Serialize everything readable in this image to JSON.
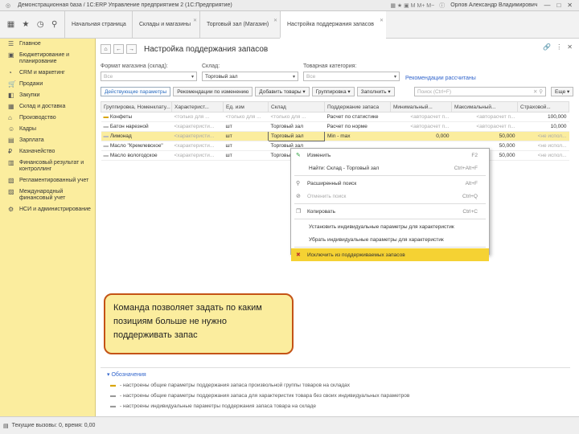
{
  "window": {
    "title": "Демонстрационная база / 1С:ERP Управление предприятием 2  (1С:Предприятие)",
    "user": "Орлов Александр Владимирович"
  },
  "tabs": [
    {
      "label": "Начальная страница"
    },
    {
      "label": "Склады и магазины"
    },
    {
      "label": "Торговый зал (Магазин)"
    },
    {
      "label": "Настройка поддержания запасов"
    }
  ],
  "sidebar": {
    "items": [
      {
        "label": "Главное",
        "icon": "list-icon"
      },
      {
        "label": "Бюджетирование и планирование",
        "icon": "budget-icon"
      },
      {
        "label": "CRM и маркетинг",
        "icon": "pie-icon"
      },
      {
        "label": "Продажи",
        "icon": "cart-icon"
      },
      {
        "label": "Закупки",
        "icon": "purchase-icon"
      },
      {
        "label": "Склад и доставка",
        "icon": "warehouse-icon"
      },
      {
        "label": "Производство",
        "icon": "factory-icon"
      },
      {
        "label": "Кадры",
        "icon": "people-icon"
      },
      {
        "label": "Зарплата",
        "icon": "salary-icon"
      },
      {
        "label": "Казначейство",
        "icon": "treasury-icon"
      },
      {
        "label": "Финансовый результат и контроллинг",
        "icon": "finance-icon"
      },
      {
        "label": "Регламентированный учет",
        "icon": "ledger-icon"
      },
      {
        "label": "Международный финансовый учет",
        "icon": "intl-icon"
      },
      {
        "label": "НСИ и администрирование",
        "icon": "settings-icon"
      }
    ]
  },
  "status": {
    "text": "Текущие вызовы: 0, время: 0,00"
  },
  "page": {
    "title": "Настройка поддержания запасов",
    "filters": {
      "format_label": "Формат магазина (склад):",
      "format_placeholder": "Все",
      "warehouse_label": "Склад:",
      "warehouse_value": "Торговый зал",
      "category_label": "Товарная категория:",
      "category_placeholder": "Все",
      "recommendations_link": "Рекомендации рассчитаны"
    },
    "toolbar": {
      "active_params": "Действующие параметры",
      "changed_recs": "Рекомендации по изменению",
      "add_goods": "Добавить товары",
      "grouping": "Группировка",
      "fill": "Заполнить",
      "search_placeholder": "Поиск (Ctrl+F)",
      "more": "Еще"
    },
    "table": {
      "columns": [
        "Группировка, Номенклату...",
        "Характерист...",
        "Ед. изм",
        "Склад",
        "Поддержание запаса",
        "Минимальный...",
        "Максимальный...",
        "Страховой..."
      ],
      "rows": [
        {
          "name": "Конфеты",
          "char": "<только для ...",
          "unit": "<только для ...",
          "wh": "<только для ...",
          "support": "Расчет по статистике",
          "min": "<авторасчет п...",
          "max": "<авторасчет п...",
          "safety": "100,000",
          "icon": "folder-icon"
        },
        {
          "name": "Батон нарезной",
          "char": "<характеристи...",
          "unit": "шт",
          "wh": "Торговый зал",
          "support": "Расчет по норме",
          "min": "<авторасчет п...",
          "max": "<авторасчет п...",
          "safety": "10,000",
          "icon": ""
        },
        {
          "name": "Лимонад",
          "char": "<характеристи...",
          "unit": "шт",
          "wh": "Торговый зал",
          "support": "Min - max",
          "min": "0,000",
          "max": "50,000",
          "safety": "<не испол...",
          "icon": ""
        },
        {
          "name": "Масло \"Кремлевское\"",
          "char": "<характеристи...",
          "unit": "шт",
          "wh": "Торговый зал",
          "support": "",
          "min": "",
          "max": "50,000",
          "safety": "<не испол...",
          "icon": ""
        },
        {
          "name": "Масло вологодское",
          "char": "<характеристи...",
          "unit": "шт",
          "wh": "Торговый зал",
          "support": "",
          "min": "",
          "max": "50,000",
          "safety": "<не испол...",
          "icon": ""
        }
      ]
    }
  },
  "context_menu": {
    "items": [
      {
        "label": "Изменить",
        "shortcut": "F2",
        "icon": "pencil-icon"
      },
      {
        "label": "Найти: Склад - Торговый зал",
        "shortcut": "Ctrl+Alt+F",
        "icon": ""
      },
      {
        "label": "Расширенный поиск",
        "shortcut": "Alt+F",
        "icon": "search-icon"
      },
      {
        "label": "Отменить поиск",
        "shortcut": "Ctrl+Q",
        "icon": "cancel-search-icon"
      },
      {
        "label": "Копировать",
        "shortcut": "Ctrl+C",
        "icon": "copy-icon"
      },
      {
        "label": "Установить индивидуальные параметры для характеристик",
        "shortcut": "",
        "icon": ""
      },
      {
        "label": "Убрать индивидуальные параметры для характеристик",
        "shortcut": "",
        "icon": ""
      },
      {
        "label": "Исключить из поддерживаемых запасов",
        "shortcut": "",
        "icon": "exclude-icon"
      }
    ]
  },
  "callout": {
    "text": "Команда позволяет задать по каким позициям больше не нужно поддерживать запас"
  },
  "legend": {
    "title": "Обозначения",
    "lines": [
      "- настроены общие параметры поддержания запаса произвольной группы товаров на складах",
      "- настроены общие параметры поддержания запаса для характеристик товара без своих индивидуальных параметров",
      "- настроены индивидуальные параметры поддержания запаса товара на складе"
    ]
  },
  "colors": {
    "accent": "#fbed9e",
    "callout_border": "#c45316",
    "link": "#3366cc"
  }
}
